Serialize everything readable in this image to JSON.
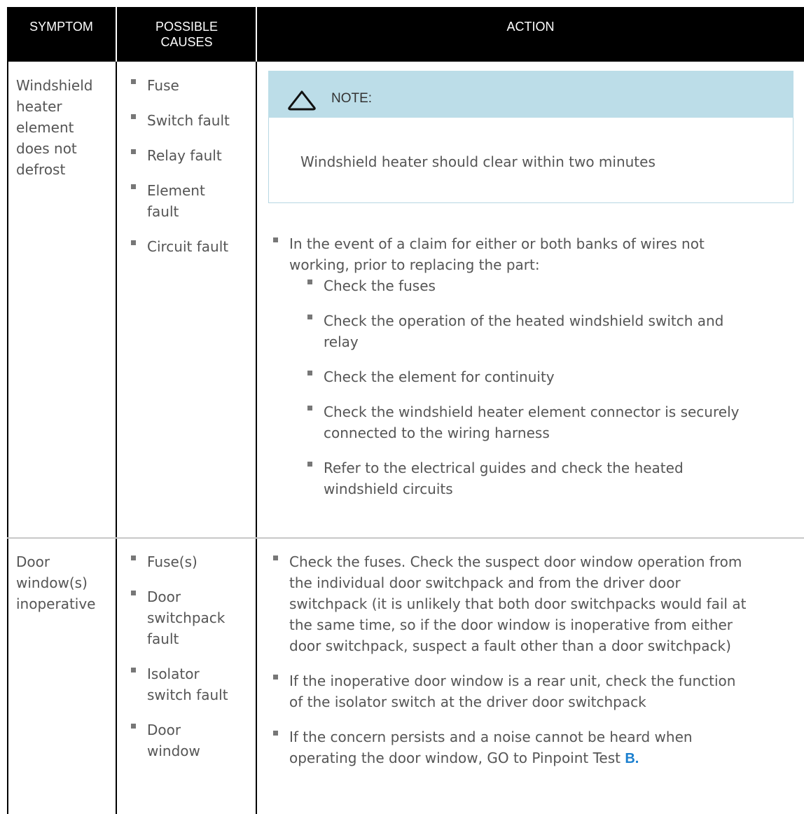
{
  "header": {
    "symptom": "SYMPTOM",
    "causes_line1": "POSSIBLE",
    "causes_line2": "CAUSES",
    "action": "ACTION"
  },
  "rows": [
    {
      "symptom_lines": [
        "Windshield",
        "heater",
        "element",
        "does not",
        "defrost"
      ],
      "causes": [
        [
          "Fuse"
        ],
        [
          "Switch fault"
        ],
        [
          "Relay fault"
        ],
        [
          "Element",
          "fault"
        ],
        [
          "Circuit fault"
        ]
      ],
      "note": {
        "title": "NOTE:",
        "icon": "warning-triangle-icon",
        "text": "Windshield heater should clear within two minutes"
      },
      "action_intro_lines": [
        "In the event of a claim for either or both banks of wires not",
        "working, prior to replacing the part:"
      ],
      "sub_actions": [
        [
          "Check the fuses"
        ],
        [
          "Check the operation of the heated windshield switch and",
          "relay"
        ],
        [
          "Check the element for continuity"
        ],
        [
          "Check the windshield heater element connector is securely",
          "connected to the wiring harness"
        ],
        [
          "Refer to the electrical guides and check the heated",
          "windshield circuits"
        ]
      ]
    },
    {
      "symptom_lines": [
        "Door",
        "window(s)",
        "inoperative"
      ],
      "causes": [
        [
          "Fuse(s)"
        ],
        [
          "Door",
          "switchpack",
          "fault"
        ],
        [
          "Isolator",
          "switch fault"
        ],
        [
          "Door",
          "window"
        ]
      ],
      "actions": [
        [
          "Check the fuses. Check the suspect door window operation from",
          "the individual door switchpack and from the driver door",
          "switchpack (it is unlikely that both door switchpacks would fail at",
          "the same time, so if the door window is inoperative from either",
          "door switchpack, suspect a fault other than a door switchpack)"
        ],
        [
          "If the inoperative door window is a rear unit, check the function",
          "of the isolator switch at the driver door switchpack"
        ],
        [
          "If the concern persists and a noise cannot be heard when"
        ]
      ],
      "last_line_prefix": "operating the door window, GO to Pinpoint Test ",
      "link_text": "B."
    }
  ],
  "colors": {
    "header_bg": "#000000",
    "note_bg": "#bcdde8",
    "link": "#1a7fcf"
  }
}
